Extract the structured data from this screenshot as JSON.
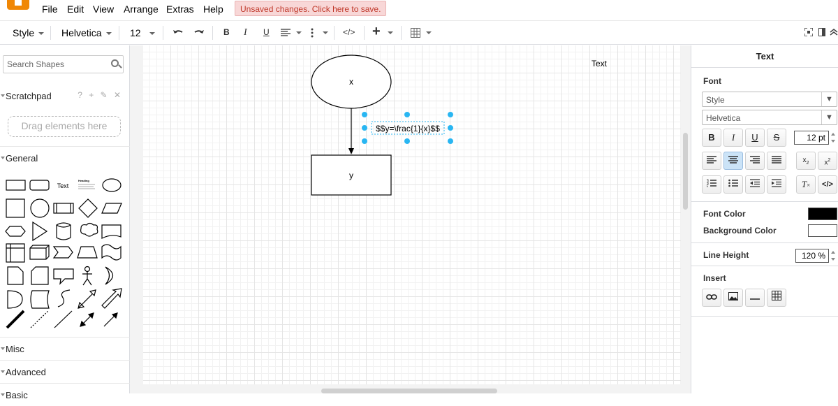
{
  "menu": {
    "items": [
      "File",
      "Edit",
      "View",
      "Arrange",
      "Extras",
      "Help"
    ],
    "unsaved": "Unsaved changes. Click here to save."
  },
  "toolbar": {
    "style_label": "Style",
    "font_label": "Helvetica",
    "size_label": "12",
    "bold": "B",
    "italic": "I",
    "underline": "U",
    "code": "</>",
    "insert": "+"
  },
  "sidebar": {
    "search_placeholder": "Search Shapes",
    "scratchpad": "Scratchpad",
    "scratchpad_icons": "? + ✎ ✕",
    "dropzone": "Drag elements here",
    "general": "General",
    "text_shape_label": "Text",
    "heading_shape_label": "Heading",
    "misc": "Misc",
    "advanced": "Advanced",
    "basic": "Basic"
  },
  "canvas": {
    "node_x": "x",
    "node_y": "y",
    "equation": "$$y=\\frac{1}{x}$$",
    "free_text": "Text"
  },
  "panel": {
    "title": "Text",
    "font_section": "Font",
    "style_select": "Style",
    "font_select": "Helvetica",
    "font_size": "12 pt",
    "font_color_label": "Font Color",
    "background_color_label": "Background Color",
    "font_color": "#000000",
    "background_color": "#ffffff",
    "line_height_label": "Line Height",
    "line_height": "120 %",
    "insert_label": "Insert"
  },
  "colors": {
    "brand": "#f08705",
    "selection": "#29b6f2",
    "unsaved_text": "#c0392b"
  }
}
